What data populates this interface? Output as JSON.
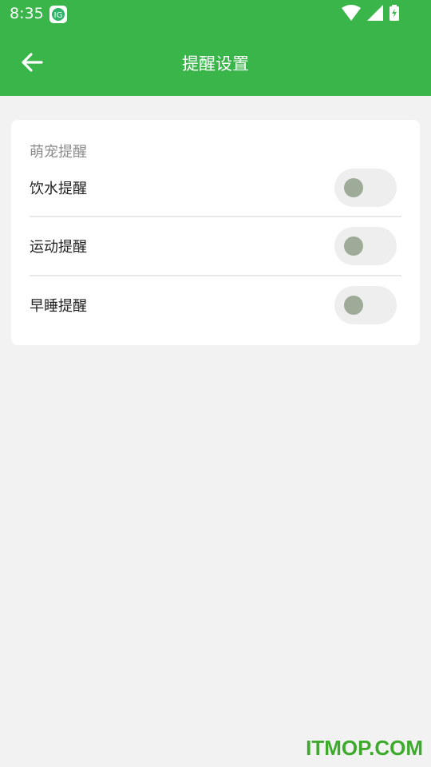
{
  "status_bar": {
    "time": "8:35",
    "icons": [
      "app-notification-icon",
      "wifi-icon",
      "signal-icon",
      "battery-charging-icon"
    ]
  },
  "app_bar": {
    "title": "提醒设置",
    "back_icon": "arrow-left-icon"
  },
  "card": {
    "section_title": "萌宠提醒",
    "rows": [
      {
        "label": "饮水提醒",
        "enabled": false
      },
      {
        "label": "运动提醒",
        "enabled": false
      },
      {
        "label": "早睡提醒",
        "enabled": false
      }
    ]
  },
  "watermark": "ITMOP.COM",
  "colors": {
    "primary": "#39b54a",
    "background": "#f2f2f2",
    "toggle_track_off": "#eeeeee",
    "toggle_knob_off": "#9eab98"
  }
}
